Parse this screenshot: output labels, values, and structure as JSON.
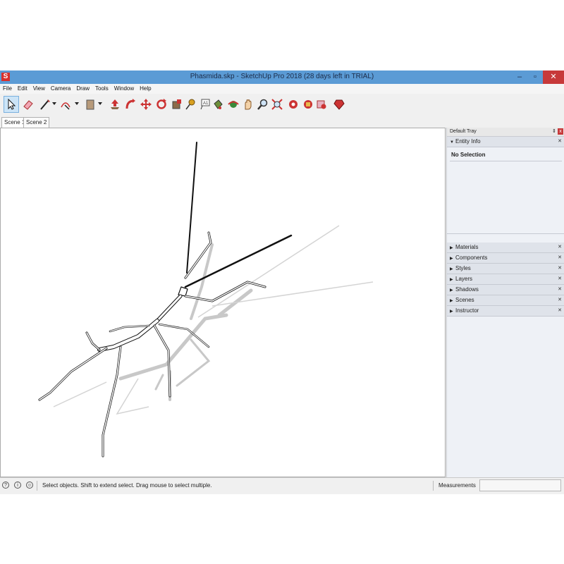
{
  "window": {
    "title": "Phasmida.skp - SketchUp Pro 2018 (28 days left in TRIAL)",
    "min": "–",
    "max": "▫",
    "close": "✕"
  },
  "menu": [
    "File",
    "Edit",
    "View",
    "Camera",
    "Draw",
    "Tools",
    "Window",
    "Help"
  ],
  "toolbar": {
    "icons": [
      "select-icon",
      "eraser-icon",
      "line-icon",
      "arc-icon",
      "rectangle-icon",
      "push-pull-icon",
      "follow-me-icon",
      "move-icon",
      "rotate-icon",
      "scale-icon",
      "tape-measure-icon",
      "text-icon",
      "paint-bucket-icon",
      "orbit-icon",
      "pan-icon",
      "zoom-icon",
      "zoom-extents-icon",
      "warehouse-icon",
      "extension-icon",
      "layout-icon",
      "ruby-icon"
    ]
  },
  "scenes": [
    "Scene 1",
    "Scene 2"
  ],
  "tray": {
    "title": "Default Tray",
    "pin": "⇕",
    "close": "x",
    "entity_info": {
      "label": "Entity Info",
      "selection": "No Selection"
    },
    "panels": [
      "Materials",
      "Components",
      "Styles",
      "Layers",
      "Shadows",
      "Scenes",
      "Instructor"
    ]
  },
  "status": {
    "message": "Select objects. Shift to extend select. Drag mouse to select multiple.",
    "measurements_label": "Measurements",
    "measurements_value": ""
  },
  "colors": {
    "titlebar": "#5b9bd5",
    "close": "#c7393a",
    "logo": "#d9302c"
  }
}
